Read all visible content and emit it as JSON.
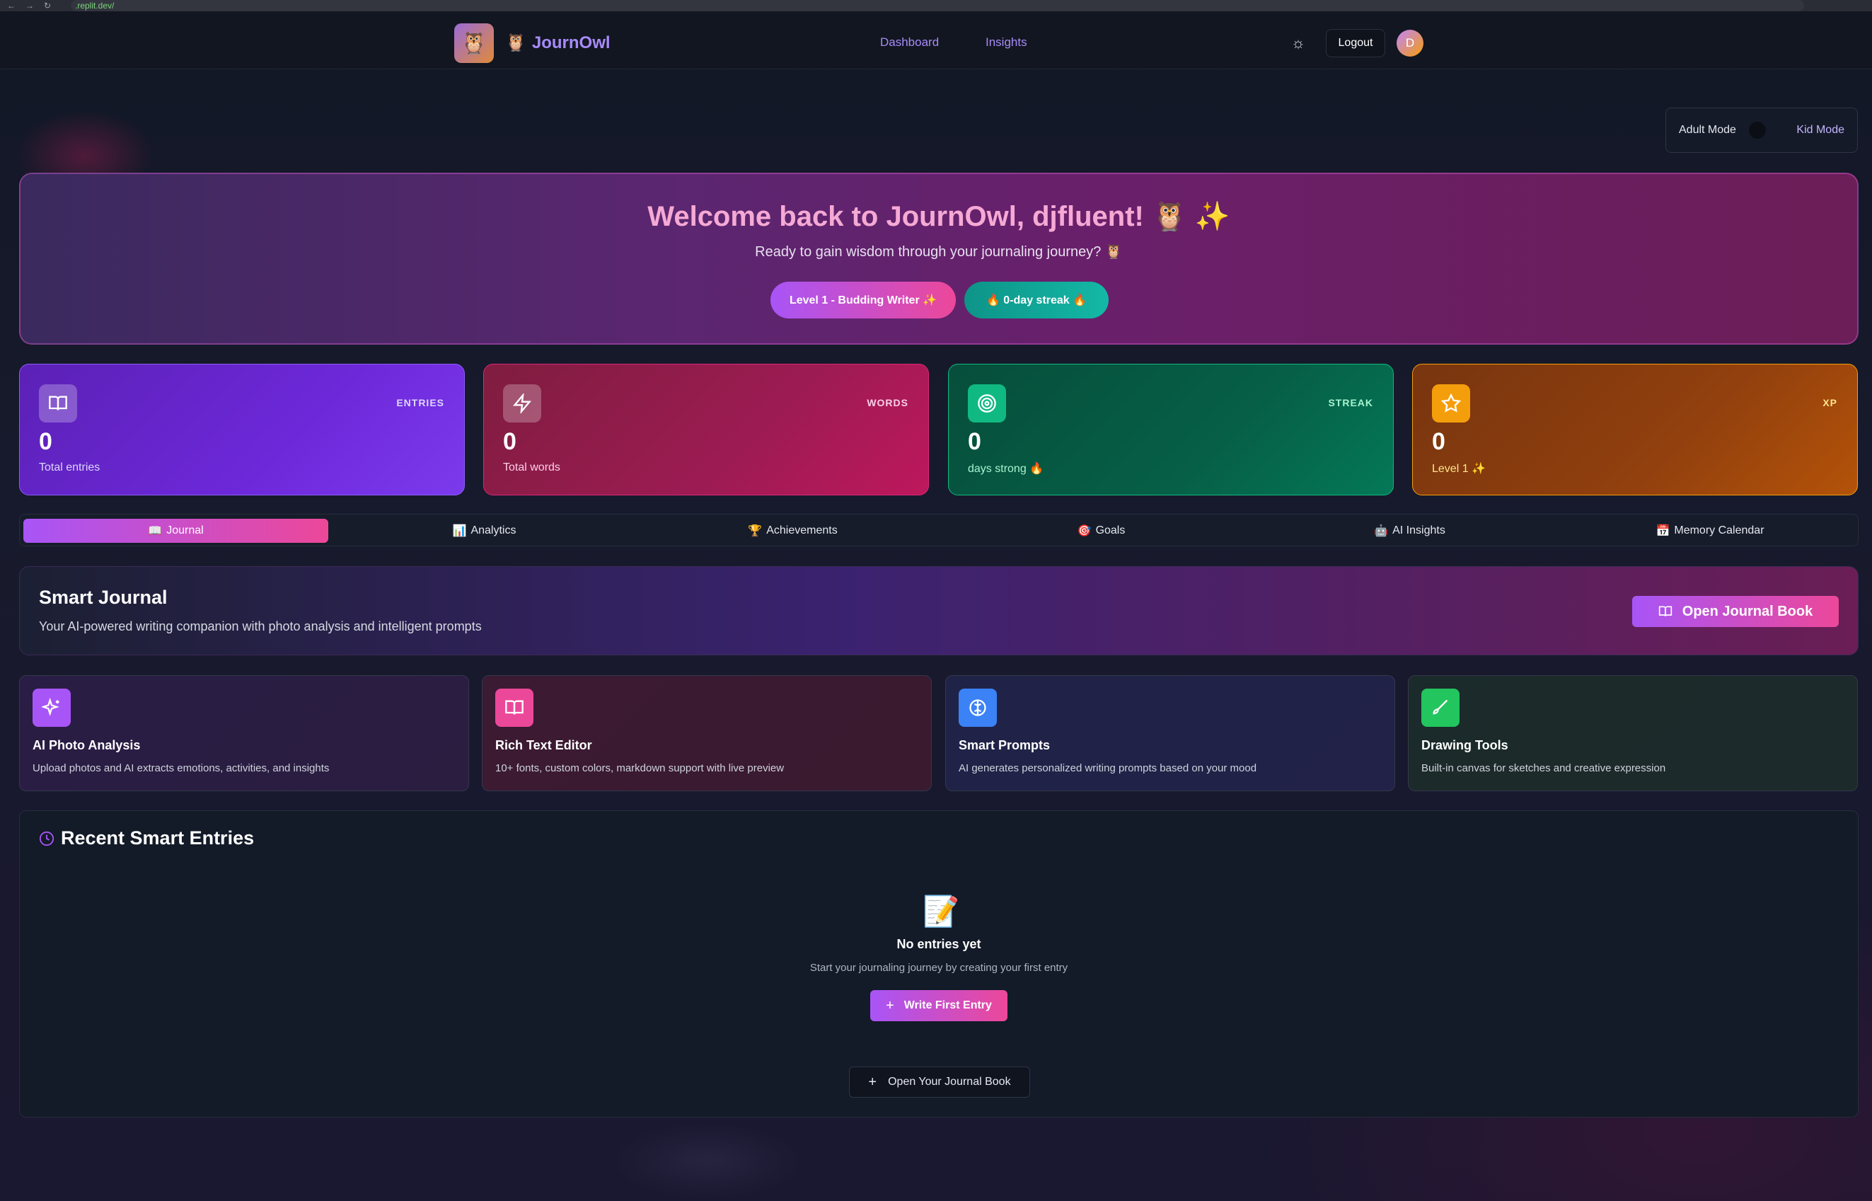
{
  "browser": {
    "url": ".replit.dev/"
  },
  "header": {
    "logo_emoji": "🦉",
    "brand_emoji": "🦉",
    "brand": "JournOwl",
    "nav": [
      "Dashboard",
      "Insights"
    ],
    "logout": "Logout",
    "avatar_initial": "D"
  },
  "mode_toggle": {
    "adult": "Adult Mode",
    "kid": "Kid Mode"
  },
  "hero": {
    "title": "Welcome back to JournOwl, djfluent! 🦉 ✨",
    "subtitle": "Ready to gain wisdom through your journaling journey? 🦉",
    "level_pill": "Level 1 - Budding Writer ✨",
    "streak_pill": "🔥 0-day streak 🔥"
  },
  "stats": [
    {
      "label": "ENTRIES",
      "value": "0",
      "caption": "Total entries",
      "icon": "book-icon"
    },
    {
      "label": "WORDS",
      "value": "0",
      "caption": "Total words",
      "icon": "lightning-icon"
    },
    {
      "label": "STREAK",
      "value": "0",
      "caption": "days strong 🔥",
      "icon": "target-icon"
    },
    {
      "label": "XP",
      "value": "0",
      "caption": "Level 1 ✨",
      "icon": "star-icon"
    }
  ],
  "tabs": [
    {
      "emoji": "📖",
      "label": "Journal"
    },
    {
      "emoji": "📊",
      "label": "Analytics"
    },
    {
      "emoji": "🏆",
      "label": "Achievements"
    },
    {
      "emoji": "🎯",
      "label": "Goals"
    },
    {
      "emoji": "🤖",
      "label": "AI Insights"
    },
    {
      "emoji": "📅",
      "label": "Memory Calendar"
    }
  ],
  "smart_journal": {
    "title": "Smart Journal",
    "description": "Your AI-powered writing companion with photo analysis and intelligent prompts",
    "button": "Open Journal Book"
  },
  "features": [
    {
      "title": "AI Photo Analysis",
      "description": "Upload photos and AI extracts emotions, activities, and insights",
      "icon": "sparkles-icon"
    },
    {
      "title": "Rich Text Editor",
      "description": "10+ fonts, custom colors, markdown support with live preview",
      "icon": "book-open-icon"
    },
    {
      "title": "Smart Prompts",
      "description": "AI generates personalized writing prompts based on your mood",
      "icon": "brain-icon"
    },
    {
      "title": "Drawing Tools",
      "description": "Built-in canvas for sketches and creative expression",
      "icon": "brush-icon"
    }
  ],
  "recent": {
    "title": "Recent Smart Entries",
    "empty_emoji": "📝",
    "empty_title": "No entries yet",
    "empty_description": "Start your journaling journey by creating your first entry",
    "write_button": "Write First Entry",
    "open_button": "Open Your Journal Book"
  },
  "colors": {
    "accent_purple": "#a855f7",
    "accent_pink": "#ec4899",
    "brand": "#a78bfa"
  }
}
